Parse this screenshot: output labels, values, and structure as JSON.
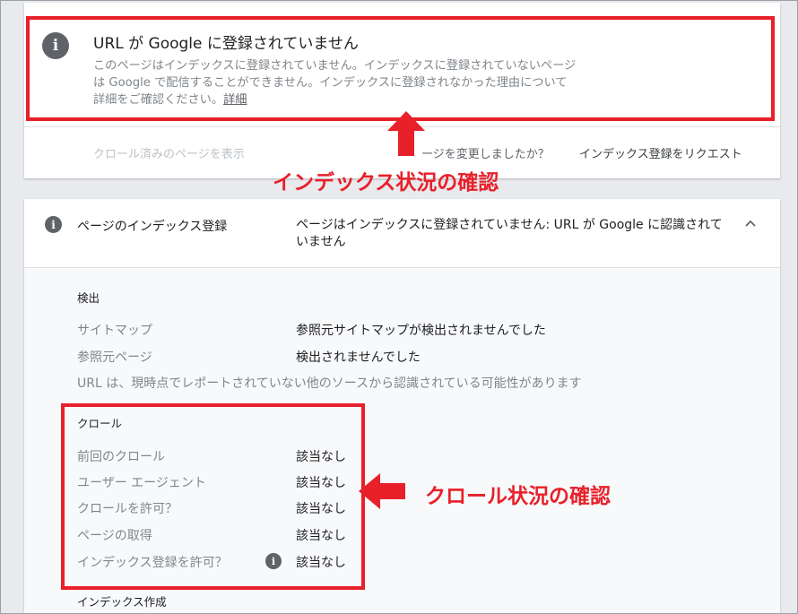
{
  "status": {
    "title": "URL が Google に登録されていません",
    "description": "このページはインデックスに登録されていません。インデックスに登録されていないページは Google で配信することができません。インデックスに登録されなかった理由について詳細をご確認ください。",
    "detail_link": "詳細",
    "icon": "info-icon"
  },
  "actions": {
    "view_crawled": "クロール済みのページを表示",
    "changed_question": "ージを変更しましたか？",
    "request_indexing": "インデックス登録をリクエスト"
  },
  "annotations": {
    "index_status": "インデックス状況の確認",
    "crawl_status": "クロール状況の確認",
    "color": "#e8202a"
  },
  "coverage": {
    "label": "ページのインデックス登録",
    "value": "ページはインデックスに登録されていません: URL が Google に認識されていません",
    "icon": "info-icon",
    "toggle_icon": "chevron-up-icon"
  },
  "discovery": {
    "heading": "検出",
    "rows": [
      {
        "label": "サイトマップ",
        "value": "参照元サイトマップが検出されませんでした"
      },
      {
        "label": "参照元ページ",
        "value": "検出されませんでした"
      }
    ],
    "note": "URL は、現時点でレポートされていない他のソースから認識されている可能性があります"
  },
  "crawl": {
    "heading": "クロール",
    "rows": [
      {
        "label": "前回のクロール",
        "value": "該当なし"
      },
      {
        "label": "ユーザー エージェント",
        "value": "該当なし"
      },
      {
        "label": "クロールを許可？",
        "value": "該当なし"
      },
      {
        "label": "ページの取得",
        "value": "該当なし"
      },
      {
        "label": "インデックス登録を許可？",
        "value": "該当なし"
      }
    ]
  },
  "indexing": {
    "heading": "インデックス作成"
  }
}
